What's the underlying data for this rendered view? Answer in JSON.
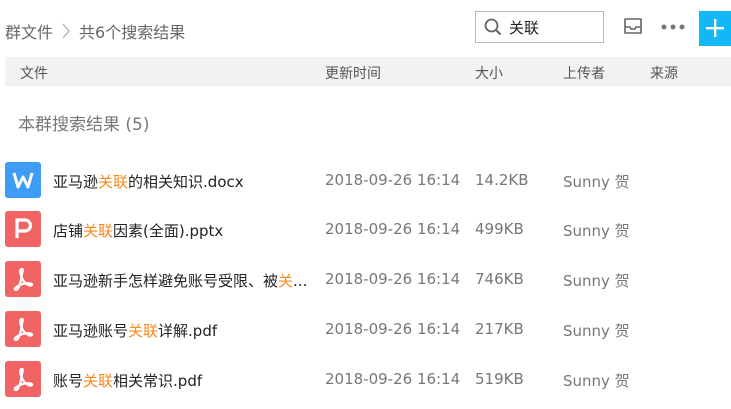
{
  "header": {
    "crumb_root": "群文件",
    "crumb_current": "共6个搜索结果",
    "search_value": "关联",
    "colors": {
      "accent": "#12b7f5",
      "highlight": "#f58a1f",
      "word_icon": "#3f9cf4",
      "red_icon": "#f06464"
    }
  },
  "columns": {
    "name": "文件",
    "time": "更新时间",
    "size": "大小",
    "uploader": "上传者",
    "source": "来源"
  },
  "section": {
    "title": "本群搜索结果 (5)"
  },
  "files": [
    {
      "pre": "亚马逊",
      "hl": "关联",
      "post": "的相关知识.docx",
      "time": "2018-09-26 16:14",
      "size": "14.2KB",
      "uploader": "Sunny  贺",
      "icon": "word-icon"
    },
    {
      "pre": "店铺",
      "hl": "关联",
      "post": "因素(全面).pptx",
      "time": "2018-09-26 16:14",
      "size": "499KB",
      "uploader": "Sunny  贺",
      "icon": "powerpoint-icon"
    },
    {
      "pre": "亚马逊新手怎样避免账号受限、被",
      "hl": "关",
      "post": "...",
      "time": "2018-09-26 16:14",
      "size": "746KB",
      "uploader": "Sunny  贺",
      "icon": "pdf-icon"
    },
    {
      "pre": "亚马逊账号",
      "hl": "关联",
      "post": "详解.pdf",
      "time": "2018-09-26 16:14",
      "size": "217KB",
      "uploader": "Sunny  贺",
      "icon": "pdf-icon"
    },
    {
      "pre": "账号",
      "hl": "关联",
      "post": "相关常识.pdf",
      "time": "2018-09-26 16:14",
      "size": "519KB",
      "uploader": "Sunny  贺",
      "icon": "pdf-icon"
    }
  ]
}
